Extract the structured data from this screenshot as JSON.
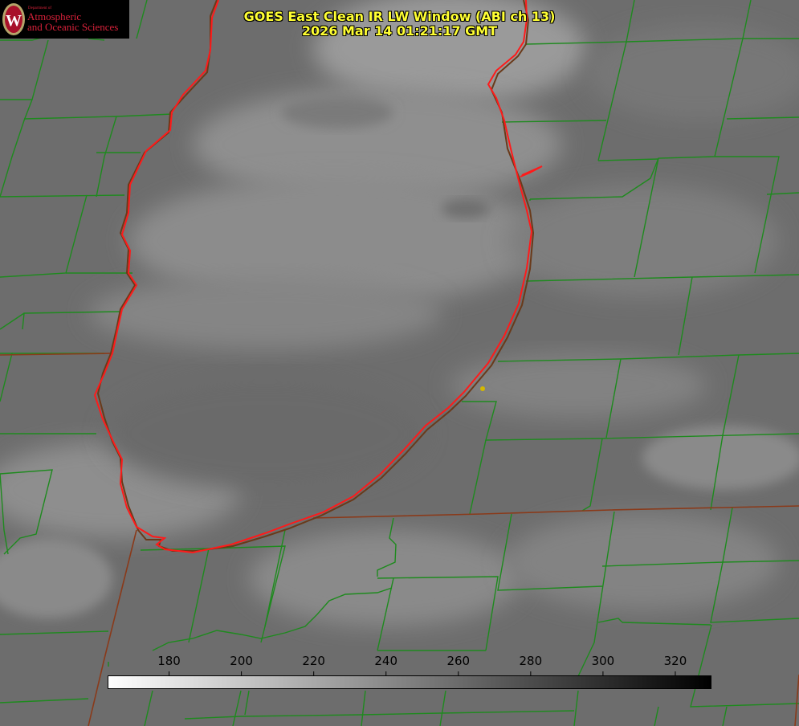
{
  "title": {
    "line1": "GOES East Clean IR LW Window (ABI ch 13)",
    "line2": "2026 Mar 14 01:21:17 GMT"
  },
  "logo": {
    "department": "Department of",
    "line1": "Atmospheric",
    "line2": "and Oceanic Sciences",
    "seal_letter": "W"
  },
  "colorbar": {
    "ticks": [
      "180",
      "200",
      "220",
      "240",
      "260",
      "280",
      "300",
      "320"
    ],
    "tick_values": [
      180,
      200,
      220,
      240,
      260,
      280,
      300,
      320
    ],
    "range": [
      163,
      330
    ],
    "gradient_start": "#ffffff",
    "gradient_end": "#000000"
  },
  "colors": {
    "county_lines": "#1e8a1e",
    "lake_outline": "#ff1a1a",
    "state_lines": "#8a3a1a",
    "title": "#ffff33",
    "marker": "#d4b800"
  }
}
